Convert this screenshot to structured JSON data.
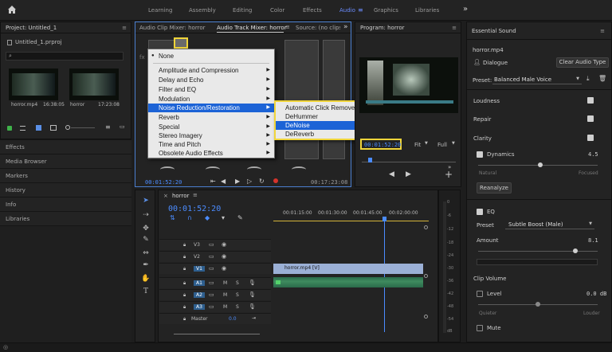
{
  "workspaces": {
    "home_icon": "home-icon",
    "items": [
      "Learning",
      "Assembly",
      "Editing",
      "Color",
      "Effects",
      "Audio",
      "Graphics",
      "Libraries"
    ],
    "active": "Audio",
    "more_icon": "double-chevron-right-icon"
  },
  "project": {
    "title": "Project: Untitled_1",
    "file": "Untitled_1.prproj",
    "clips": [
      {
        "name": "horror.mp4",
        "duration": "16:38:05"
      },
      {
        "name": "horror",
        "duration": "17:23:08"
      }
    ]
  },
  "sidebar": {
    "items": [
      "Effects",
      "Media Browser",
      "Markers",
      "History",
      "Info",
      "Libraries"
    ]
  },
  "audio_panel": {
    "tabs": [
      "Audio Clip Mixer: horror",
      "Audio Track Mixer: horror",
      "Source: (no clips)"
    ],
    "more": "»",
    "timecode_left": "00:01:52:20",
    "timecode_right": "00:17:23:08"
  },
  "effects_menu": {
    "items": [
      {
        "label": "None",
        "checked": true
      },
      {
        "label": "Amplitude and Compression",
        "submenu": true
      },
      {
        "label": "Delay and Echo",
        "submenu": true
      },
      {
        "label": "Filter and EQ",
        "submenu": true
      },
      {
        "label": "Modulation",
        "submenu": true
      },
      {
        "label": "Noise Reduction/Restoration",
        "submenu": true,
        "selected": true
      },
      {
        "label": "Reverb",
        "submenu": true
      },
      {
        "label": "Special",
        "submenu": true
      },
      {
        "label": "Stereo Imagery",
        "submenu": true
      },
      {
        "label": "Time and Pitch",
        "submenu": true
      },
      {
        "label": "Obsolete Audio Effects",
        "submenu": true
      }
    ],
    "submenu": [
      {
        "label": "Automatic Click Remover"
      },
      {
        "label": "DeHummer"
      },
      {
        "label": "DeNoise",
        "selected": true
      },
      {
        "label": "DeReverb"
      }
    ]
  },
  "program": {
    "title": "Program: horror",
    "timecode": "00:01:52:20",
    "zoom": "Fit",
    "quality": "Full"
  },
  "timeline": {
    "tab": "horror",
    "timecode": "00:01:52:20",
    "ruler": [
      "00:01:15:00",
      "00:01:30:00",
      "00:01:45:00",
      "00:02:00:00"
    ],
    "video_tracks": [
      "V3",
      "V2",
      "V1"
    ],
    "audio_tracks": [
      "A1",
      "A2",
      "A3"
    ],
    "toggles": [
      "M",
      "S"
    ],
    "master_label": "Master",
    "master_value": "0.0",
    "clip_label": "horror.mp4 [V]",
    "meter_labels": [
      "0",
      "-6",
      "-12",
      "-18",
      "-24",
      "-30",
      "-36",
      "-42",
      "-48",
      "-54"
    ],
    "meter_db": "dB"
  },
  "essential_sound": {
    "title": "Essential Sound",
    "clip": "horror.mp4",
    "type": "Dialogue",
    "clear_button": "Clear Audio Type",
    "preset_label": "Preset:",
    "preset_value": "Balanced Male Voice",
    "sections": {
      "loudness": "Loudness",
      "repair": "Repair",
      "clarity": "Clarity"
    },
    "dynamics_label": "Dynamics",
    "dynamics_value": "4.5",
    "dynamics_min": "Natural",
    "dynamics_max": "Focused",
    "dynamics_level": 0.52,
    "reanalyze": "Reanalyze",
    "eq_label": "EQ",
    "eq_preset_label": "Preset",
    "eq_preset_value": "Subtle Boost (Male)",
    "amount_label": "Amount",
    "amount_value": "8.1",
    "amount_level": 0.81,
    "clip_volume": "Clip Volume",
    "level_label": "Level",
    "level_value": "0.0 dB",
    "level_min": "Quieter",
    "level_max": "Louder",
    "level_level": 0.5,
    "mute_label": "Mute"
  },
  "colors": {
    "accent": "#4b8cff",
    "highlight": "#f0d53a",
    "menu_selected": "#1c63d6"
  }
}
